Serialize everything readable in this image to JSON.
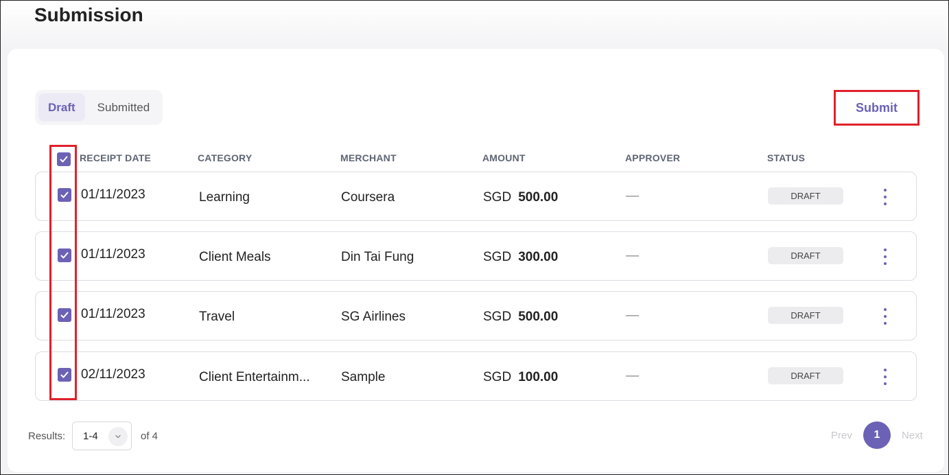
{
  "page": {
    "title": "Submission"
  },
  "tabs": [
    {
      "label": "Draft",
      "active": true
    },
    {
      "label": "Submitted",
      "active": false
    }
  ],
  "toolbar": {
    "submit_label": "Submit"
  },
  "table": {
    "headers": [
      "RECEIPT DATE",
      "CATEGORY",
      "MERCHANT",
      "AMOUNT",
      "APPROVER",
      "STATUS"
    ],
    "rows": [
      {
        "date": "01/11/2023",
        "category": "Learning",
        "merchant": "Coursera",
        "currency": "SGD",
        "amount": "500.00",
        "approver": "—",
        "status": "DRAFT"
      },
      {
        "date": "01/11/2023",
        "category": "Client Meals",
        "merchant": "Din Tai Fung",
        "currency": "SGD",
        "amount": "300.00",
        "approver": "—",
        "status": "DRAFT"
      },
      {
        "date": "01/11/2023",
        "category": "Travel",
        "merchant": "SG Airlines",
        "currency": "SGD",
        "amount": "500.00",
        "approver": "—",
        "status": "DRAFT"
      },
      {
        "date": "02/11/2023",
        "category": "Client Entertainm...",
        "merchant": "Sample",
        "currency": "SGD",
        "amount": "100.00",
        "approver": "—",
        "status": "DRAFT"
      }
    ]
  },
  "footer": {
    "results_label": "Results:",
    "results_value": "1-4",
    "of_total": "of 4",
    "prev_label": "Prev",
    "current_page": "1",
    "next_label": "Next"
  },
  "colors": {
    "accent": "#6b62b5",
    "highlight": "#e0202a"
  }
}
